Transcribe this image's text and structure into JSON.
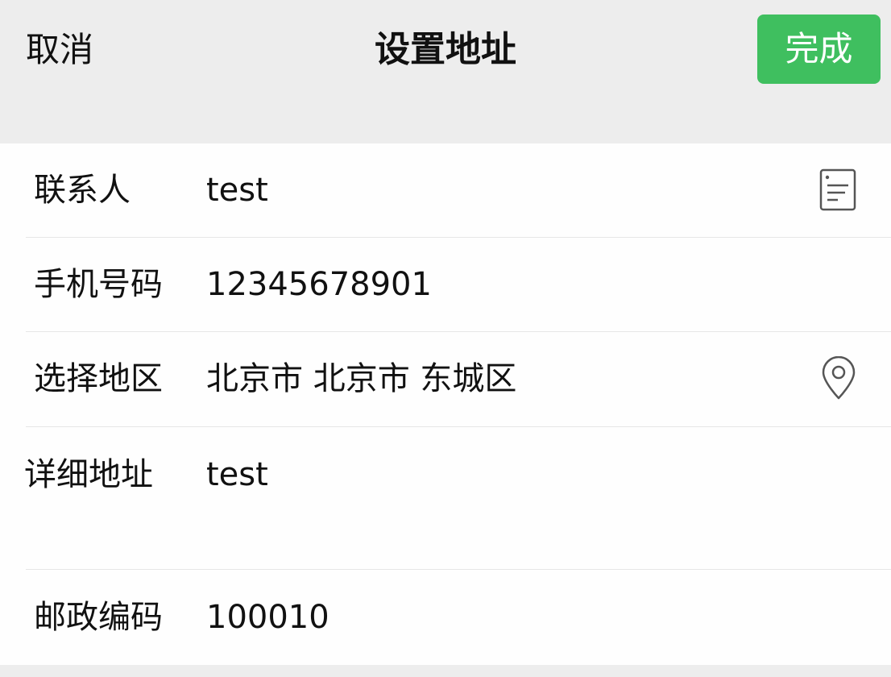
{
  "nav": {
    "cancel_label": "取消",
    "title": "设置地址",
    "done_label": "完成",
    "done_color": "#3fbf5f"
  },
  "form": {
    "contact": {
      "label": "联系人",
      "value": "test",
      "icon": "contact-card-icon"
    },
    "phone": {
      "label": "手机号码",
      "value": "12345678901"
    },
    "region": {
      "label": "选择地区",
      "value": "北京市 北京市 东城区",
      "icon": "location-pin-icon"
    },
    "detail": {
      "label": "详细地址",
      "value": "test"
    },
    "postcode": {
      "label": "邮政编码",
      "value": "100010"
    }
  }
}
